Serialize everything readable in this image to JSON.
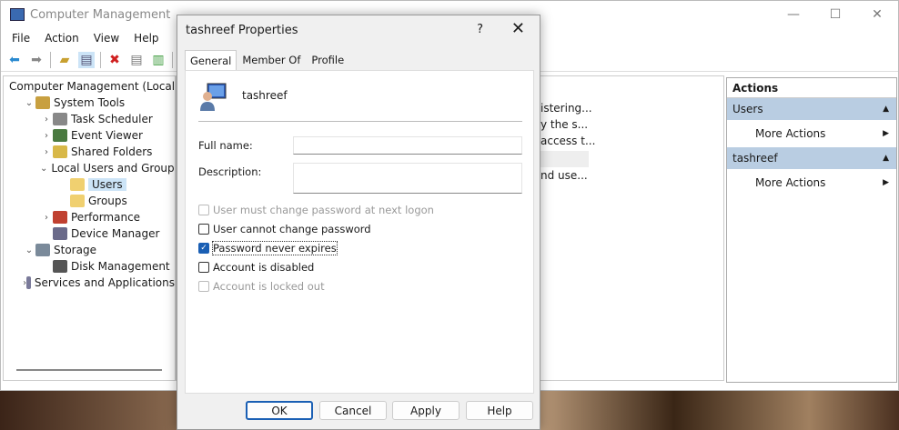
{
  "window": {
    "title": "Computer Management",
    "controls": [
      "—",
      "☐",
      "✕"
    ]
  },
  "menu": [
    "File",
    "Action",
    "View",
    "Help"
  ],
  "tree": [
    {
      "label": "Computer Management (Local",
      "indent": 0,
      "chev": "",
      "color": "#3a6ab0"
    },
    {
      "label": "System Tools",
      "indent": 1,
      "chev": "⌄",
      "color": "#c8a040"
    },
    {
      "label": "Task Scheduler",
      "indent": 2,
      "chev": "›",
      "color": "#888"
    },
    {
      "label": "Event Viewer",
      "indent": 2,
      "chev": "›",
      "color": "#4a7a40"
    },
    {
      "label": "Shared Folders",
      "indent": 2,
      "chev": "›",
      "color": "#d8b848"
    },
    {
      "label": "Local Users and Groups",
      "indent": 2,
      "chev": "⌄",
      "color": "#5a80c0"
    },
    {
      "label": "Users",
      "indent": 3,
      "chev": "",
      "color": "#f0d070",
      "selected": true
    },
    {
      "label": "Groups",
      "indent": 3,
      "chev": "",
      "color": "#f0d070"
    },
    {
      "label": "Performance",
      "indent": 2,
      "chev": "›",
      "color": "#c04030"
    },
    {
      "label": "Device Manager",
      "indent": 2,
      "chev": "",
      "color": "#6a6a8a"
    },
    {
      "label": "Storage",
      "indent": 1,
      "chev": "⌄",
      "color": "#7a8a9a"
    },
    {
      "label": "Disk Management",
      "indent": 2,
      "chev": "",
      "color": "#555"
    },
    {
      "label": "Services and Applications",
      "indent": 1,
      "chev": "›",
      "color": "#7a7a9a"
    }
  ],
  "list_fragments": [
    "istering...",
    "y the s...",
    "access t...",
    "nd use..."
  ],
  "actions": {
    "header": "Actions",
    "groups": [
      {
        "label": "Users",
        "item": "More Actions"
      },
      {
        "label": "tashreef",
        "item": "More Actions"
      }
    ]
  },
  "dialog": {
    "title": "tashreef Properties",
    "help": "?",
    "close": "✕",
    "tabs": [
      "General",
      "Member Of",
      "Profile"
    ],
    "username": "tashreef",
    "full_name_label": "Full name:",
    "full_name_value": "",
    "description_label": "Description:",
    "description_value": "",
    "checkboxes": [
      {
        "label": "User must change password at next logon",
        "checked": false,
        "disabled": true
      },
      {
        "label": "User cannot change password",
        "checked": false,
        "disabled": false
      },
      {
        "label": "Password never expires",
        "checked": true,
        "disabled": false
      },
      {
        "label": "Account is disabled",
        "checked": false,
        "disabled": false
      },
      {
        "label": "Account is locked out",
        "checked": false,
        "disabled": true
      }
    ],
    "buttons": [
      "OK",
      "Cancel",
      "Apply",
      "Help"
    ]
  }
}
